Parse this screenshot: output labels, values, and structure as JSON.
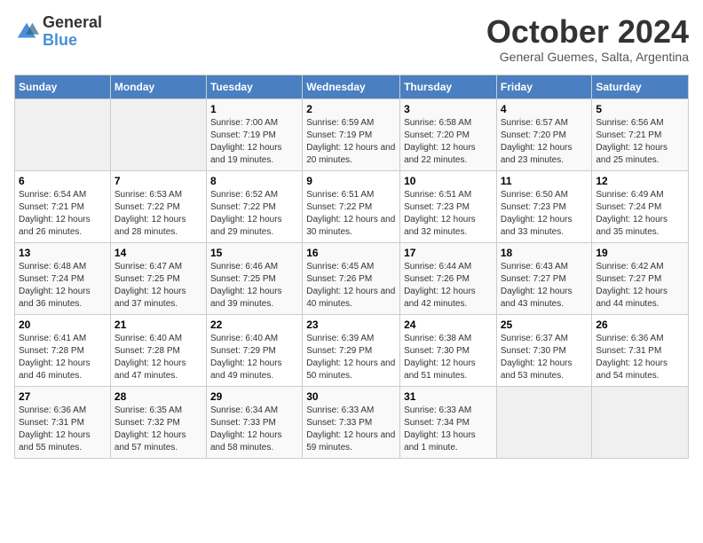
{
  "header": {
    "logo_general": "General",
    "logo_blue": "Blue",
    "month_title": "October 2024",
    "subtitle": "General Guemes, Salta, Argentina"
  },
  "days_of_week": [
    "Sunday",
    "Monday",
    "Tuesday",
    "Wednesday",
    "Thursday",
    "Friday",
    "Saturday"
  ],
  "weeks": [
    [
      {
        "num": "",
        "info": ""
      },
      {
        "num": "",
        "info": ""
      },
      {
        "num": "1",
        "info": "Sunrise: 7:00 AM\nSunset: 7:19 PM\nDaylight: 12 hours and 19 minutes."
      },
      {
        "num": "2",
        "info": "Sunrise: 6:59 AM\nSunset: 7:19 PM\nDaylight: 12 hours and 20 minutes."
      },
      {
        "num": "3",
        "info": "Sunrise: 6:58 AM\nSunset: 7:20 PM\nDaylight: 12 hours and 22 minutes."
      },
      {
        "num": "4",
        "info": "Sunrise: 6:57 AM\nSunset: 7:20 PM\nDaylight: 12 hours and 23 minutes."
      },
      {
        "num": "5",
        "info": "Sunrise: 6:56 AM\nSunset: 7:21 PM\nDaylight: 12 hours and 25 minutes."
      }
    ],
    [
      {
        "num": "6",
        "info": "Sunrise: 6:54 AM\nSunset: 7:21 PM\nDaylight: 12 hours and 26 minutes."
      },
      {
        "num": "7",
        "info": "Sunrise: 6:53 AM\nSunset: 7:22 PM\nDaylight: 12 hours and 28 minutes."
      },
      {
        "num": "8",
        "info": "Sunrise: 6:52 AM\nSunset: 7:22 PM\nDaylight: 12 hours and 29 minutes."
      },
      {
        "num": "9",
        "info": "Sunrise: 6:51 AM\nSunset: 7:22 PM\nDaylight: 12 hours and 30 minutes."
      },
      {
        "num": "10",
        "info": "Sunrise: 6:51 AM\nSunset: 7:23 PM\nDaylight: 12 hours and 32 minutes."
      },
      {
        "num": "11",
        "info": "Sunrise: 6:50 AM\nSunset: 7:23 PM\nDaylight: 12 hours and 33 minutes."
      },
      {
        "num": "12",
        "info": "Sunrise: 6:49 AM\nSunset: 7:24 PM\nDaylight: 12 hours and 35 minutes."
      }
    ],
    [
      {
        "num": "13",
        "info": "Sunrise: 6:48 AM\nSunset: 7:24 PM\nDaylight: 12 hours and 36 minutes."
      },
      {
        "num": "14",
        "info": "Sunrise: 6:47 AM\nSunset: 7:25 PM\nDaylight: 12 hours and 37 minutes."
      },
      {
        "num": "15",
        "info": "Sunrise: 6:46 AM\nSunset: 7:25 PM\nDaylight: 12 hours and 39 minutes."
      },
      {
        "num": "16",
        "info": "Sunrise: 6:45 AM\nSunset: 7:26 PM\nDaylight: 12 hours and 40 minutes."
      },
      {
        "num": "17",
        "info": "Sunrise: 6:44 AM\nSunset: 7:26 PM\nDaylight: 12 hours and 42 minutes."
      },
      {
        "num": "18",
        "info": "Sunrise: 6:43 AM\nSunset: 7:27 PM\nDaylight: 12 hours and 43 minutes."
      },
      {
        "num": "19",
        "info": "Sunrise: 6:42 AM\nSunset: 7:27 PM\nDaylight: 12 hours and 44 minutes."
      }
    ],
    [
      {
        "num": "20",
        "info": "Sunrise: 6:41 AM\nSunset: 7:28 PM\nDaylight: 12 hours and 46 minutes."
      },
      {
        "num": "21",
        "info": "Sunrise: 6:40 AM\nSunset: 7:28 PM\nDaylight: 12 hours and 47 minutes."
      },
      {
        "num": "22",
        "info": "Sunrise: 6:40 AM\nSunset: 7:29 PM\nDaylight: 12 hours and 49 minutes."
      },
      {
        "num": "23",
        "info": "Sunrise: 6:39 AM\nSunset: 7:29 PM\nDaylight: 12 hours and 50 minutes."
      },
      {
        "num": "24",
        "info": "Sunrise: 6:38 AM\nSunset: 7:30 PM\nDaylight: 12 hours and 51 minutes."
      },
      {
        "num": "25",
        "info": "Sunrise: 6:37 AM\nSunset: 7:30 PM\nDaylight: 12 hours and 53 minutes."
      },
      {
        "num": "26",
        "info": "Sunrise: 6:36 AM\nSunset: 7:31 PM\nDaylight: 12 hours and 54 minutes."
      }
    ],
    [
      {
        "num": "27",
        "info": "Sunrise: 6:36 AM\nSunset: 7:31 PM\nDaylight: 12 hours and 55 minutes."
      },
      {
        "num": "28",
        "info": "Sunrise: 6:35 AM\nSunset: 7:32 PM\nDaylight: 12 hours and 57 minutes."
      },
      {
        "num": "29",
        "info": "Sunrise: 6:34 AM\nSunset: 7:33 PM\nDaylight: 12 hours and 58 minutes."
      },
      {
        "num": "30",
        "info": "Sunrise: 6:33 AM\nSunset: 7:33 PM\nDaylight: 12 hours and 59 minutes."
      },
      {
        "num": "31",
        "info": "Sunrise: 6:33 AM\nSunset: 7:34 PM\nDaylight: 13 hours and 1 minute."
      },
      {
        "num": "",
        "info": ""
      },
      {
        "num": "",
        "info": ""
      }
    ]
  ]
}
